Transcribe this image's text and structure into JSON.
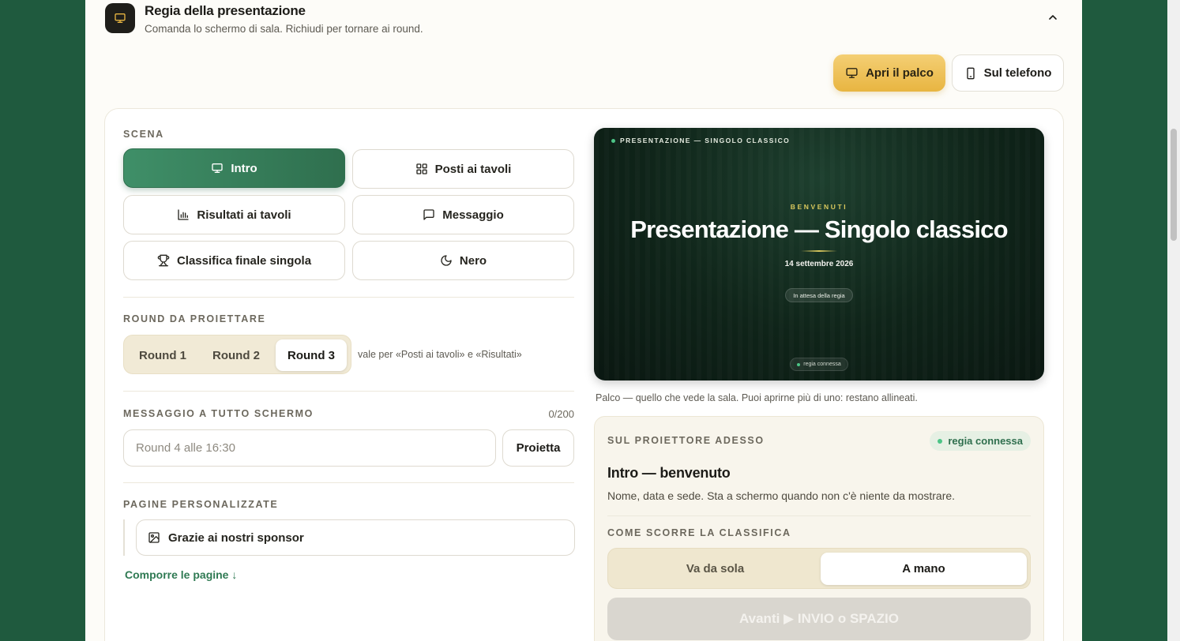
{
  "header": {
    "title": "Regia della presentazione",
    "subtitle": "Comanda lo schermo di sala. Richiudi per tornare ai round."
  },
  "toolbar": {
    "stage_label": "Apri il palco",
    "phone_label": "Sul telefono"
  },
  "scene": {
    "label": "SCENA",
    "buttons": [
      {
        "label": "Intro",
        "icon": "monitor-icon",
        "active": true
      },
      {
        "label": "Posti ai tavoli",
        "icon": "grid-icon",
        "active": false
      },
      {
        "label": "Risultati ai tavoli",
        "icon": "bar-chart-icon",
        "active": false
      },
      {
        "label": "Messaggio",
        "icon": "message-icon",
        "active": false
      },
      {
        "label": "Classifica finale singola",
        "icon": "trophy-icon",
        "active": false
      },
      {
        "label": "Nero",
        "icon": "moon-icon",
        "active": false
      }
    ]
  },
  "rounds": {
    "label": "ROUND DA PROIETTARE",
    "options": [
      "Round 1",
      "Round 2",
      "Round 3"
    ],
    "selected": "Round 3",
    "note": "vale per «Posti ai tavoli» e «Risultati»"
  },
  "message": {
    "label": "MESSAGGIO A TUTTO SCHERMO",
    "counter": "0/200",
    "placeholder": "Round 4 alle 16:30",
    "value": "",
    "project_label": "Proietta"
  },
  "custom_pages": {
    "label": "PAGINE PERSONALIZZATE",
    "items": [
      {
        "label": "Grazie ai nostri sponsor",
        "icon": "image-icon"
      }
    ],
    "compose_link": "Comporre le pagine ↓"
  },
  "preview": {
    "top_label": "PRESENTAZIONE — SINGOLO CLASSICO",
    "welcome": "BENVENUTI",
    "title": "Presentazione — Singolo classico",
    "date": "14 settembre 2026",
    "waiting": "In attesa della regia",
    "connection": "regia connessa",
    "caption": "Palco — quello che vede la sala. Puoi aprirne più di uno: restano allineati."
  },
  "status": {
    "label": "SUL PROIETTORE ADESSO",
    "badge": "regia connessa",
    "now_title": "Intro — benvenuto",
    "now_desc": "Nome, data e sede. Sta a schermo quando non c'è niente da mostrare.",
    "scroll_label": "COME SCORRE LA CLASSIFICA",
    "scroll_options": [
      "Va da sola",
      "A mano"
    ],
    "scroll_selected": "A mano",
    "next_label": "Avanti ▶ INVIO o SPAZIO"
  },
  "colors": {
    "background": "#1f5a3e",
    "accent_green": "#2f6f4e",
    "gold": "#e8b541"
  }
}
